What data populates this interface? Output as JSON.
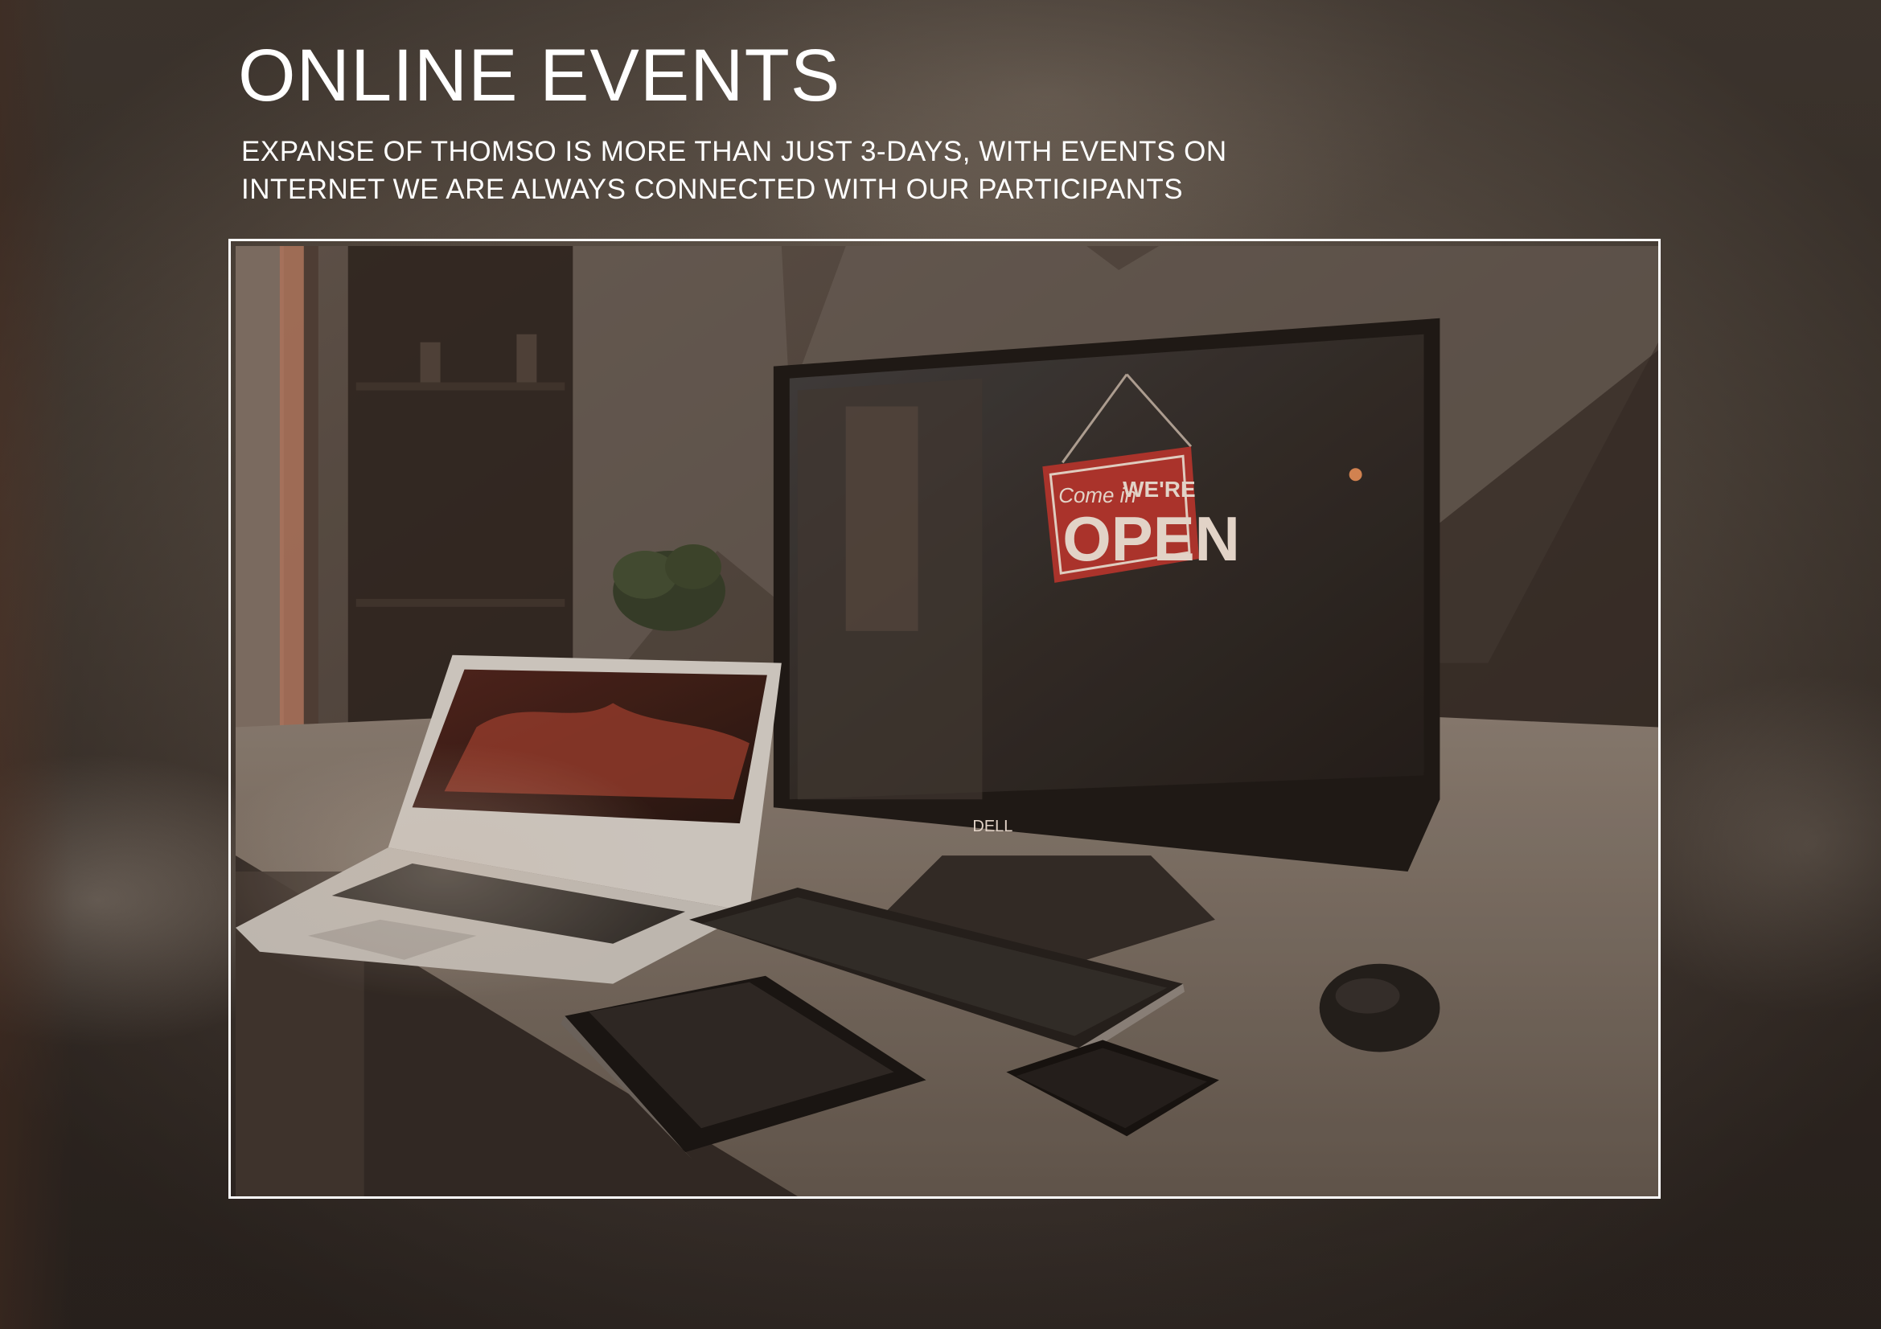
{
  "header": {
    "title": "ONLINE EVENTS",
    "subtitle_line1": "EXPANSE OF THOMSO IS MORE THAN JUST 3-DAYS, WITH EVENTS ON",
    "subtitle_line2": "INTERNET WE ARE ALWAYS CONNECTED WITH OUR PARTICIPANTS"
  },
  "photo": {
    "sign_script": "Come in",
    "sign_small": "WE'RE",
    "sign_big": "OPEN",
    "monitor_brand": "DELL"
  },
  "colors": {
    "text": "#ffffff",
    "frame": "#ffffff",
    "sign_red": "#b3302b"
  }
}
